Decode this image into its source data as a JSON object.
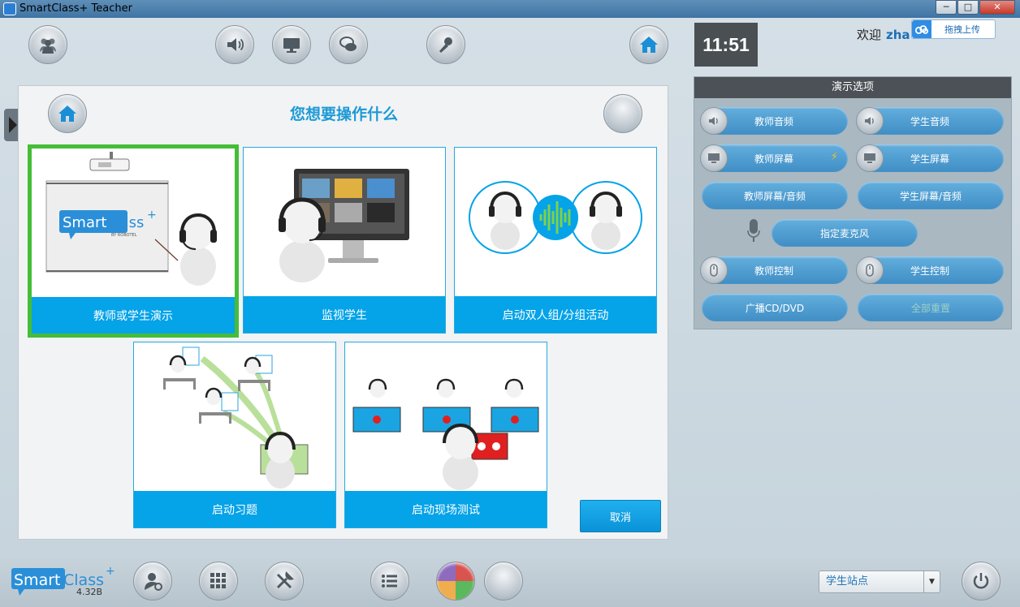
{
  "window": {
    "title": "SmartClass+ Teacher",
    "min_label": "─",
    "max_label": "□",
    "close_label": "✕"
  },
  "header": {
    "clock": "11:51",
    "welcome": "欢迎",
    "user": "zha",
    "upload_label": "拖拽上传"
  },
  "options": {
    "title": "演示选项",
    "teacher_audio": "教师音频",
    "student_audio": "学生音频",
    "teacher_screen": "教师屏幕",
    "student_screen": "学生屏幕",
    "teacher_screen_audio": "教师屏幕/音频",
    "student_screen_audio": "学生屏幕/音频",
    "assign_mic": "指定麦克风",
    "teacher_control": "教师控制",
    "student_control": "学生控制",
    "broadcast_cd": "广播CD/DVD",
    "reset_all": "全部重置"
  },
  "dialog": {
    "title": "您想要操作什么",
    "cards": {
      "demo": "教师或学生演示",
      "monitor": "监视学生",
      "pair": "启动双人组/分组活动",
      "exercise": "启动习题",
      "quiz": "启动现场测试"
    },
    "cancel": "取消",
    "brand_smart": "Smart",
    "brand_class": "Class",
    "brand_plus": "+",
    "brand_by": "BY ROBOTEL"
  },
  "footer": {
    "brand_smart": "Smart",
    "brand_class": "Class",
    "brand_plus": "+",
    "version": "4.32B",
    "station": "学生站点"
  },
  "colors": {
    "accent": "#05a3e8",
    "selected_outline": "#45bd38",
    "title_blue": "#1d9ad6",
    "pill_blue": "#3f8ec5"
  }
}
